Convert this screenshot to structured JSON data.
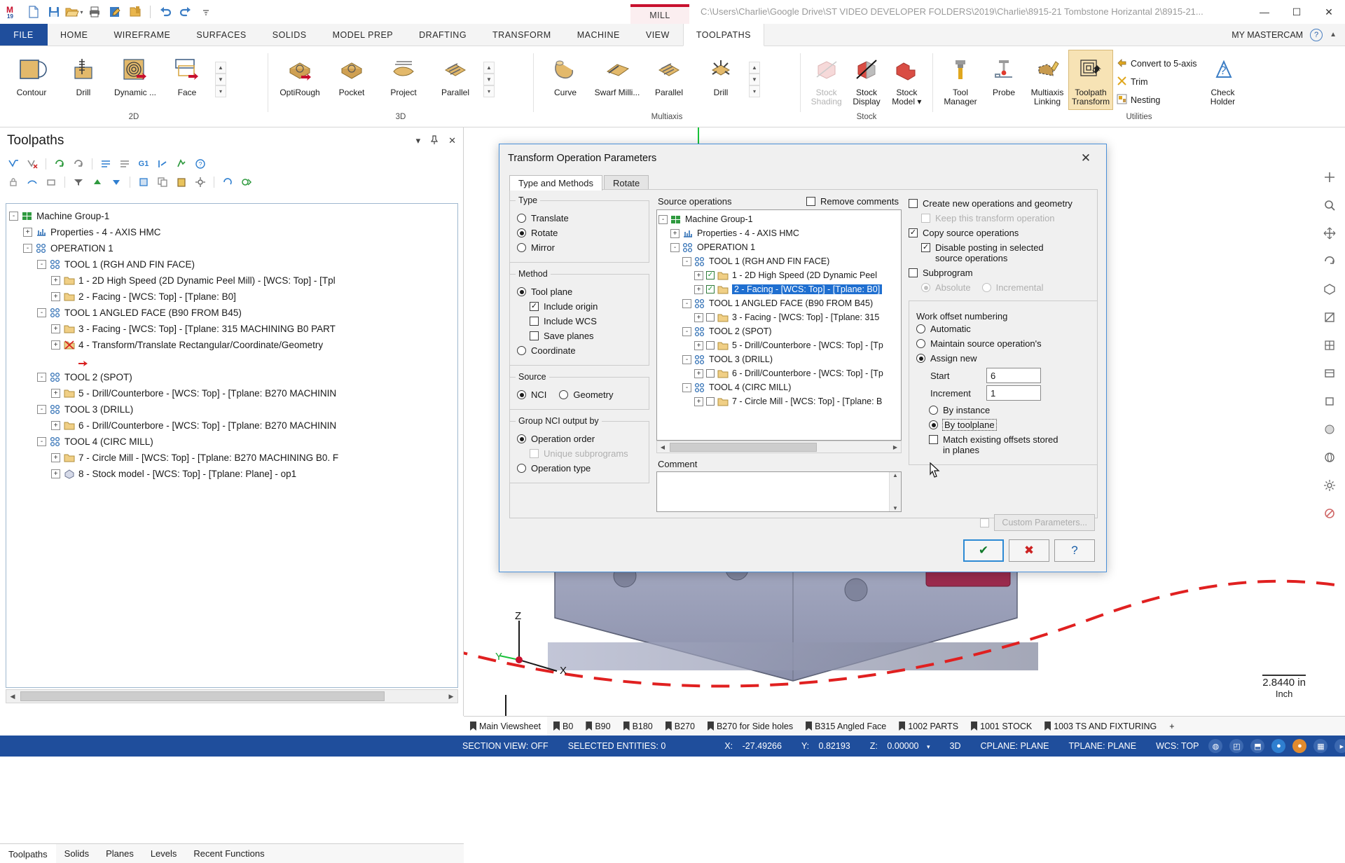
{
  "titlebar": {
    "quick_access": [
      {
        "name": "mastercam-logo-icon",
        "label": "M19"
      },
      {
        "name": "new-file-icon",
        "label": "New"
      },
      {
        "name": "save-icon",
        "label": "Save"
      },
      {
        "name": "open-folder-icon",
        "label": "Open"
      },
      {
        "name": "print-icon",
        "label": "Print"
      },
      {
        "name": "edit-file-icon",
        "label": "Edit"
      },
      {
        "name": "import-folder-icon",
        "label": "Import"
      },
      {
        "name": "undo-icon",
        "label": "Undo"
      },
      {
        "name": "redo-icon",
        "label": "Redo"
      },
      {
        "name": "customize-qat-icon",
        "label": "Customize"
      }
    ],
    "machine_tab": "MILL",
    "document_path": "C:\\Users\\Charlie\\Google Drive\\ST VIDEO DEVELOPER FOLDERS\\2019\\Charlie\\8915-21 Tombstone Horizantal 2\\8915-21...",
    "minimize": "—",
    "maximize": "☐",
    "close": "✕"
  },
  "ribbon": {
    "tabs": [
      {
        "label": "FILE",
        "active": false,
        "file": true
      },
      {
        "label": "HOME",
        "active": false
      },
      {
        "label": "WIREFRAME",
        "active": false
      },
      {
        "label": "SURFACES",
        "active": false
      },
      {
        "label": "SOLIDS",
        "active": false
      },
      {
        "label": "MODEL PREP",
        "active": false
      },
      {
        "label": "DRAFTING",
        "active": false
      },
      {
        "label": "TRANSFORM",
        "active": false
      },
      {
        "label": "MACHINE",
        "active": false
      },
      {
        "label": "VIEW",
        "active": false
      },
      {
        "label": "TOOLPATHS",
        "active": true
      }
    ],
    "account_label": "MY MASTERCAM",
    "help_label": "?",
    "collapse_label": "▲",
    "groups": [
      {
        "title": "2D",
        "buttons": [
          {
            "label": "Contour",
            "icon": "contour-icon"
          },
          {
            "label": "Drill",
            "icon": "drill-icon"
          },
          {
            "label": "Dynamic ...",
            "icon": "dynamic-mill-icon"
          },
          {
            "label": "Face",
            "icon": "face-icon"
          }
        ],
        "has_spinner": true
      },
      {
        "title": "3D",
        "buttons": [
          {
            "label": "OptiRough",
            "icon": "optirough-icon"
          },
          {
            "label": "Pocket",
            "icon": "pocket-icon"
          },
          {
            "label": "Project",
            "icon": "project-icon"
          },
          {
            "label": "Parallel",
            "icon": "parallel-3d-icon"
          }
        ],
        "has_spinner": true
      },
      {
        "title": "Multiaxis",
        "buttons": [
          {
            "label": "Curve",
            "icon": "curve-icon"
          },
          {
            "label": "Swarf Milli...",
            "icon": "swarf-mill-icon"
          },
          {
            "label": "Parallel",
            "icon": "parallel-multiaxis-icon"
          },
          {
            "label": "Drill",
            "icon": "multiaxis-drill-icon"
          }
        ],
        "has_spinner": true
      },
      {
        "title": "Stock",
        "buttons": [
          {
            "label": "Stock Shading",
            "icon": "stock-shading-icon",
            "disabled": true
          },
          {
            "label": "Stock Display",
            "icon": "stock-display-icon"
          },
          {
            "label": "Stock Model ▾",
            "icon": "stock-model-icon"
          }
        ],
        "has_spinner": false
      },
      {
        "title": "Utilities",
        "buttons": [
          {
            "label": "Tool Manager",
            "icon": "tool-manager-icon"
          },
          {
            "label": "Probe",
            "icon": "probe-icon"
          },
          {
            "label": "Multiaxis Linking",
            "icon": "multiaxis-linking-icon"
          },
          {
            "label": "Toolpath Transform",
            "icon": "toolpath-transform-icon"
          }
        ],
        "small_buttons": [
          {
            "label": "Convert to 5-axis",
            "icon": "convert-5axis-icon"
          },
          {
            "label": "Trim",
            "icon": "trim-icon"
          },
          {
            "label": "Nesting",
            "icon": "nesting-icon"
          }
        ],
        "tail_button": {
          "label": "Check Holder",
          "icon": "check-holder-icon"
        },
        "has_spinner": false
      }
    ]
  },
  "toolpaths_panel": {
    "title": "Toolpaths",
    "header_actions": [
      {
        "name": "panel-dropdown-icon",
        "glyph": "▾"
      },
      {
        "name": "panel-pin-icon",
        "glyph": "📌"
      },
      {
        "name": "panel-close-icon",
        "glyph": "✕"
      }
    ],
    "toolbar_row1": [
      "select-all-icon",
      "select-invert-icon",
      "regen-dirty-icon",
      "regen-all-icon",
      "sep",
      "post-icon",
      "post-selected-icon",
      "g1-icon",
      "simulate-icon",
      "verify-icon",
      "help-icon"
    ],
    "toolbar_row2": [
      "lock-icon",
      "toggle-posting-icon",
      "toggle-display-icon",
      "sep",
      "filter-icon",
      "move-up-icon",
      "move-down-icon",
      "sep",
      "single-select-icon",
      "copy-icon",
      "paste-icon",
      "tool-settings-icon",
      "sep",
      "refresh-icon",
      "advanced-icon"
    ],
    "tree": [
      {
        "depth": 0,
        "expander": "-",
        "icon": "machine-group-icon",
        "label": "Machine Group-1"
      },
      {
        "depth": 1,
        "expander": "+",
        "icon": "properties-icon",
        "label": "Properties - 4 - AXIS HMC"
      },
      {
        "depth": 1,
        "expander": "-",
        "icon": "operation-group-icon",
        "label": "OPERATION 1"
      },
      {
        "depth": 2,
        "expander": "-",
        "icon": "toolgroup-icon",
        "label": "TOOL 1 (RGH AND FIN FACE)"
      },
      {
        "depth": 3,
        "expander": "+",
        "icon": "folder-icon",
        "label": "1 - 2D High Speed (2D Dynamic Peel Mill) - [WCS: Top] - [Tpl"
      },
      {
        "depth": 3,
        "expander": "+",
        "icon": "folder-icon",
        "label": "2 - Facing - [WCS: Top] - [Tplane: B0]"
      },
      {
        "depth": 2,
        "expander": "-",
        "icon": "toolgroup-icon",
        "label": "TOOL 1 ANGLED FACE (B90 FROM B45)"
      },
      {
        "depth": 3,
        "expander": "+",
        "icon": "folder-icon",
        "label": "3 - Facing - [WCS: Top] - [Tplane: 315 MACHINING B0 PART"
      },
      {
        "depth": 3,
        "expander": "+",
        "icon": "transform-red-x-icon",
        "label": "4 - Transform/Translate Rectangular/Coordinate/Geometry"
      },
      {
        "depth": 4,
        "expander": "",
        "icon": "red-arrow-icon",
        "label": ""
      },
      {
        "depth": 2,
        "expander": "-",
        "icon": "toolgroup-icon",
        "label": "TOOL 2 (SPOT)"
      },
      {
        "depth": 3,
        "expander": "+",
        "icon": "folder-icon",
        "label": "5 - Drill/Counterbore - [WCS: Top] - [Tplane: B270 MACHININ"
      },
      {
        "depth": 2,
        "expander": "-",
        "icon": "toolgroup-icon",
        "label": "TOOL 3 (DRILL)"
      },
      {
        "depth": 3,
        "expander": "+",
        "icon": "folder-icon",
        "label": "6 - Drill/Counterbore - [WCS: Top] - [Tplane: B270 MACHININ"
      },
      {
        "depth": 2,
        "expander": "-",
        "icon": "toolgroup-icon",
        "label": "TOOL 4 (CIRC MILL)"
      },
      {
        "depth": 3,
        "expander": "+",
        "icon": "folder-icon",
        "label": "7 - Circle Mill - [WCS: Top] - [Tplane: B270 MACHINING B0. F"
      },
      {
        "depth": 3,
        "expander": "+",
        "icon": "stockmodel-tree-icon",
        "label": "8 - Stock model - [WCS: Top] - [Tplane: Plane] - op1"
      }
    ],
    "bottom_tabs": [
      {
        "label": "Toolpaths",
        "active": true
      },
      {
        "label": "Solids",
        "active": false
      },
      {
        "label": "Planes",
        "active": false
      },
      {
        "label": "Levels",
        "active": false
      },
      {
        "label": "Recent Functions",
        "active": false
      }
    ]
  },
  "dialog": {
    "title": "Transform Operation Parameters",
    "close_glyph": "✕",
    "tabs": [
      {
        "label": "Type and Methods",
        "active": true
      },
      {
        "label": "Rotate",
        "active": false
      }
    ],
    "type_group": {
      "label": "Type",
      "options": [
        {
          "label": "Translate",
          "selected": false
        },
        {
          "label": "Rotate",
          "selected": true
        },
        {
          "label": "Mirror",
          "selected": false
        }
      ]
    },
    "method_group": {
      "label": "Method",
      "options": [
        {
          "label": "Tool plane",
          "selected": true
        },
        {
          "label": "Coordinate",
          "selected": false
        }
      ],
      "checkboxes": [
        {
          "label": "Include origin",
          "checked": true
        },
        {
          "label": "Include WCS",
          "checked": false
        },
        {
          "label": "Save planes",
          "checked": false
        }
      ]
    },
    "source_group": {
      "label": "Source",
      "options": [
        {
          "label": "NCI",
          "selected": true
        },
        {
          "label": "Geometry",
          "selected": false
        }
      ]
    },
    "group_nci_group": {
      "label": "Group NCI output by",
      "options": [
        {
          "label": "Operation order",
          "selected": true
        },
        {
          "label": "Operation type",
          "selected": false
        }
      ],
      "checkbox": {
        "label": "Unique subprograms",
        "checked": false,
        "disabled": true
      }
    },
    "source_operations": {
      "label": "Source operations",
      "remove_comments": {
        "label": "Remove comments",
        "checked": false
      },
      "tree": [
        {
          "depth": 0,
          "expander": "-",
          "icon": "machine-group-icon",
          "label": "Machine Group-1",
          "selected": false,
          "check": null
        },
        {
          "depth": 1,
          "expander": "+",
          "icon": "properties-icon",
          "label": "Properties - 4 - AXIS HMC",
          "selected": false,
          "check": null
        },
        {
          "depth": 1,
          "expander": "-",
          "icon": "operation-group-icon",
          "label": "OPERATION 1",
          "selected": false,
          "check": null
        },
        {
          "depth": 2,
          "expander": "-",
          "icon": "toolgroup-icon",
          "label": "TOOL 1 (RGH AND FIN FACE)",
          "selected": false,
          "check": null
        },
        {
          "depth": 3,
          "expander": "+",
          "icon": "folder-icon",
          "label": "1 - 2D High Speed (2D Dynamic Peel",
          "selected": false,
          "check": true
        },
        {
          "depth": 3,
          "expander": "+",
          "icon": "folder-icon",
          "label": "2 - Facing - [WCS: Top] - [Tplane: B0]",
          "selected": true,
          "check": true
        },
        {
          "depth": 2,
          "expander": "-",
          "icon": "toolgroup-icon",
          "label": "TOOL 1 ANGLED FACE (B90 FROM B45)",
          "selected": false,
          "check": null
        },
        {
          "depth": 3,
          "expander": "+",
          "icon": "folder-icon",
          "label": "3 - Facing - [WCS: Top] - [Tplane: 315",
          "selected": false,
          "check": false
        },
        {
          "depth": 2,
          "expander": "-",
          "icon": "toolgroup-icon",
          "label": "TOOL 2 (SPOT)",
          "selected": false,
          "check": null
        },
        {
          "depth": 3,
          "expander": "+",
          "icon": "folder-icon",
          "label": "5 - Drill/Counterbore - [WCS: Top] - [Tp",
          "selected": false,
          "check": false
        },
        {
          "depth": 2,
          "expander": "-",
          "icon": "toolgroup-icon",
          "label": "TOOL 3 (DRILL)",
          "selected": false,
          "check": null
        },
        {
          "depth": 3,
          "expander": "+",
          "icon": "folder-icon",
          "label": "6 - Drill/Counterbore - [WCS: Top] - [Tp",
          "selected": false,
          "check": false
        },
        {
          "depth": 2,
          "expander": "-",
          "icon": "toolgroup-icon",
          "label": "TOOL 4 (CIRC MILL)",
          "selected": false,
          "check": null
        },
        {
          "depth": 3,
          "expander": "+",
          "icon": "folder-icon",
          "label": "7 - Circle Mill - [WCS: Top] - [Tplane: B",
          "selected": false,
          "check": false
        }
      ]
    },
    "comment": {
      "label": "Comment",
      "value": "",
      "placeholder": ""
    },
    "right_options": {
      "create_new": {
        "label": "Create new operations and geometry",
        "checked": false
      },
      "keep_transform": {
        "label": "Keep this transform operation",
        "checked": false,
        "disabled": true
      },
      "copy_source": {
        "label": "Copy source operations",
        "checked": true
      },
      "disable_posting": {
        "label": "Disable posting in selected source operations",
        "checked": true
      },
      "subprogram": {
        "label": "Subprogram",
        "checked": false
      },
      "absolute": {
        "label": "Absolute",
        "selected": true,
        "disabled": true
      },
      "incremental": {
        "label": "Incremental",
        "selected": false,
        "disabled": true
      }
    },
    "work_offset": {
      "label": "Work offset numbering",
      "options": [
        {
          "label": "Automatic",
          "selected": false
        },
        {
          "label": "Maintain source operation's",
          "selected": false
        },
        {
          "label": "Assign new",
          "selected": true
        }
      ],
      "start": {
        "label": "Start",
        "value": "6"
      },
      "increment": {
        "label": "Increment",
        "value": "1"
      },
      "by_instance": {
        "label": "By instance",
        "selected": false
      },
      "by_toolplane": {
        "label": "By toolplane",
        "selected": true,
        "focused": true
      },
      "match_existing": {
        "label": "Match existing offsets stored in planes",
        "checked": false
      }
    },
    "custom_parameters": {
      "label": "Custom Parameters...",
      "checked": false,
      "disabled": true
    },
    "footer_buttons": [
      {
        "name": "ok-button",
        "glyph": "✔",
        "kind": "ok"
      },
      {
        "name": "cancel-button",
        "glyph": "✖",
        "kind": "cancel"
      },
      {
        "name": "help-button",
        "glyph": "?",
        "kind": "help"
      }
    ]
  },
  "viewport": {
    "dimension_value": "2.8440 in",
    "dimension_unit": "Inch",
    "axis": {
      "x": "X",
      "y": "Y",
      "z": "Z"
    },
    "rail_buttons": [
      "fit-icon",
      "zoom-window-icon",
      "unzoom-icon",
      "pan-icon",
      "rotate-icon",
      "isometric-icon",
      "top-view-icon",
      "front-view-icon",
      "side-view-icon",
      "wireframe-icon",
      "shaded-icon",
      "section-icon",
      "settings-icon",
      "blank-icon"
    ]
  },
  "sheet_tabs": [
    {
      "label": "Main Viewsheet",
      "active": true
    },
    {
      "label": "B0",
      "active": false
    },
    {
      "label": "B90",
      "active": false
    },
    {
      "label": "B180",
      "active": false
    },
    {
      "label": "B270",
      "active": false
    },
    {
      "label": "B270 for  Side holes",
      "active": false
    },
    {
      "label": "B315 Angled Face",
      "active": false
    },
    {
      "label": "1002 PARTS",
      "active": false
    },
    {
      "label": "1001 STOCK",
      "active": false
    },
    {
      "label": "1003 TS AND FIXTURING",
      "active": false
    },
    {
      "label": "+",
      "active": false,
      "is_add": true
    }
  ],
  "statusbar": {
    "section_view": "SECTION VIEW: OFF",
    "selected_entities": "SELECTED ENTITIES: 0",
    "x_label": "X:",
    "x_value": "-27.49266",
    "y_label": "Y:",
    "y_value": "0.82193",
    "z_label": "Z:",
    "z_value": "0.00000",
    "dimension_mode": "3D",
    "cplane": "CPLANE: PLANE",
    "tplane": "TPLANE: PLANE",
    "wcs": "WCS: TOP",
    "icons": [
      "globe-icon",
      "plane-icon",
      "lock-icon",
      "blue-circle-icon",
      "orange-circle-icon",
      "grid-icon",
      "arrow-icon"
    ]
  }
}
